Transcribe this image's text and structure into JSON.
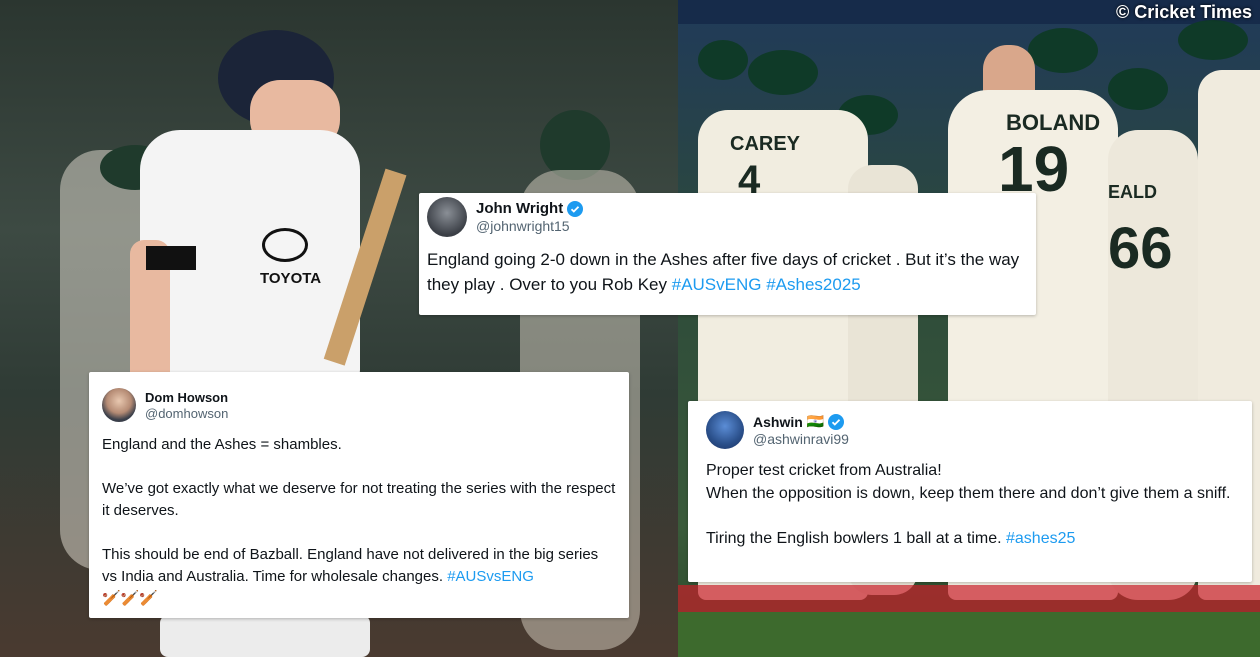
{
  "watermark": "© Cricket Times",
  "photos": {
    "left": {
      "jersey_sponsor": "TOYOTA"
    },
    "right": {
      "names": [
        "CAREY",
        "BOLAND"
      ],
      "numbers": [
        "4",
        "19",
        "66"
      ],
      "partial_name": "EALD"
    }
  },
  "tweets": [
    {
      "name": "John Wright",
      "handle": "@johnwright15",
      "verified": true,
      "text_before": "England going 2-0 down in the Ashes after five days of cricket . But it’s the way they play . Over to you Rob Key ",
      "tags": "#AUSvENG #Ashes2025"
    },
    {
      "name": "Dom Howson",
      "handle": "@domhowson",
      "verified": false,
      "p1": "England and the Ashes = shambles.",
      "p2": "We’ve got exactly what we deserve for not treating the series with the respect it deserves.",
      "p3": "This should be end of Bazball. England have not delivered in the big series vs India and Australia. Time for wholesale changes. ",
      "p3_tag": "#AUSvsENG",
      "emoji": "🏏🏏🏏"
    },
    {
      "name": "Ashwin",
      "flag": "🇮🇳",
      "handle": "@ashwinravi99",
      "verified": true,
      "p1": "Proper test cricket from Australia!",
      "p2": "When the opposition is down, keep them there and don’t give them a sniff.",
      "p3": "Tiring the English bowlers 1 ball at a time. ",
      "p3_tag": "#ashes25"
    }
  ],
  "colors": {
    "link": "#1d9bf0",
    "verified": "#1d9bf0",
    "text": "#0f1419",
    "muted": "#536471"
  }
}
